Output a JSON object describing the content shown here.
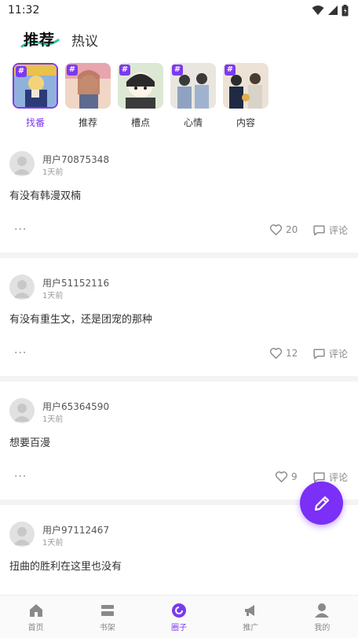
{
  "status_bar": {
    "time": "11:32"
  },
  "top_tabs": {
    "active": "推荐",
    "inactive": "热议"
  },
  "topics": [
    {
      "label": "找番",
      "hash": "#",
      "active": true
    },
    {
      "label": "推荐",
      "hash": "#",
      "active": false
    },
    {
      "label": "槽点",
      "hash": "#",
      "active": false
    },
    {
      "label": "心情",
      "hash": "#",
      "active": false
    },
    {
      "label": "内容",
      "hash": "#",
      "active": false
    }
  ],
  "posts": [
    {
      "username": "用户70875348",
      "time": "1天前",
      "content": "有没有韩漫双楠",
      "likes": "20",
      "comment_label": "评论",
      "more": "···"
    },
    {
      "username": "用户51152116",
      "time": "1天前",
      "content": "有没有重生文，还是团宠的那种",
      "likes": "12",
      "comment_label": "评论",
      "more": "···"
    },
    {
      "username": "用户65364590",
      "time": "1天前",
      "content": "想要百漫",
      "likes": "9",
      "comment_label": "评论",
      "more": "···"
    },
    {
      "username": "用户97112467",
      "time": "1天前",
      "content": "扭曲的胜利在这里也没有"
    }
  ],
  "bottom_nav": [
    {
      "label": "首页",
      "icon": "home-icon",
      "active": false
    },
    {
      "label": "书架",
      "icon": "bookshelf-icon",
      "active": false
    },
    {
      "label": "圈子",
      "icon": "circle-icon",
      "active": true
    },
    {
      "label": "推广",
      "icon": "megaphone-icon",
      "active": false
    },
    {
      "label": "我的",
      "icon": "user-icon",
      "active": false
    }
  ],
  "colors": {
    "accent": "#7c3aed",
    "fab": "#7b2ff7",
    "underline": "#2bc4a0"
  }
}
